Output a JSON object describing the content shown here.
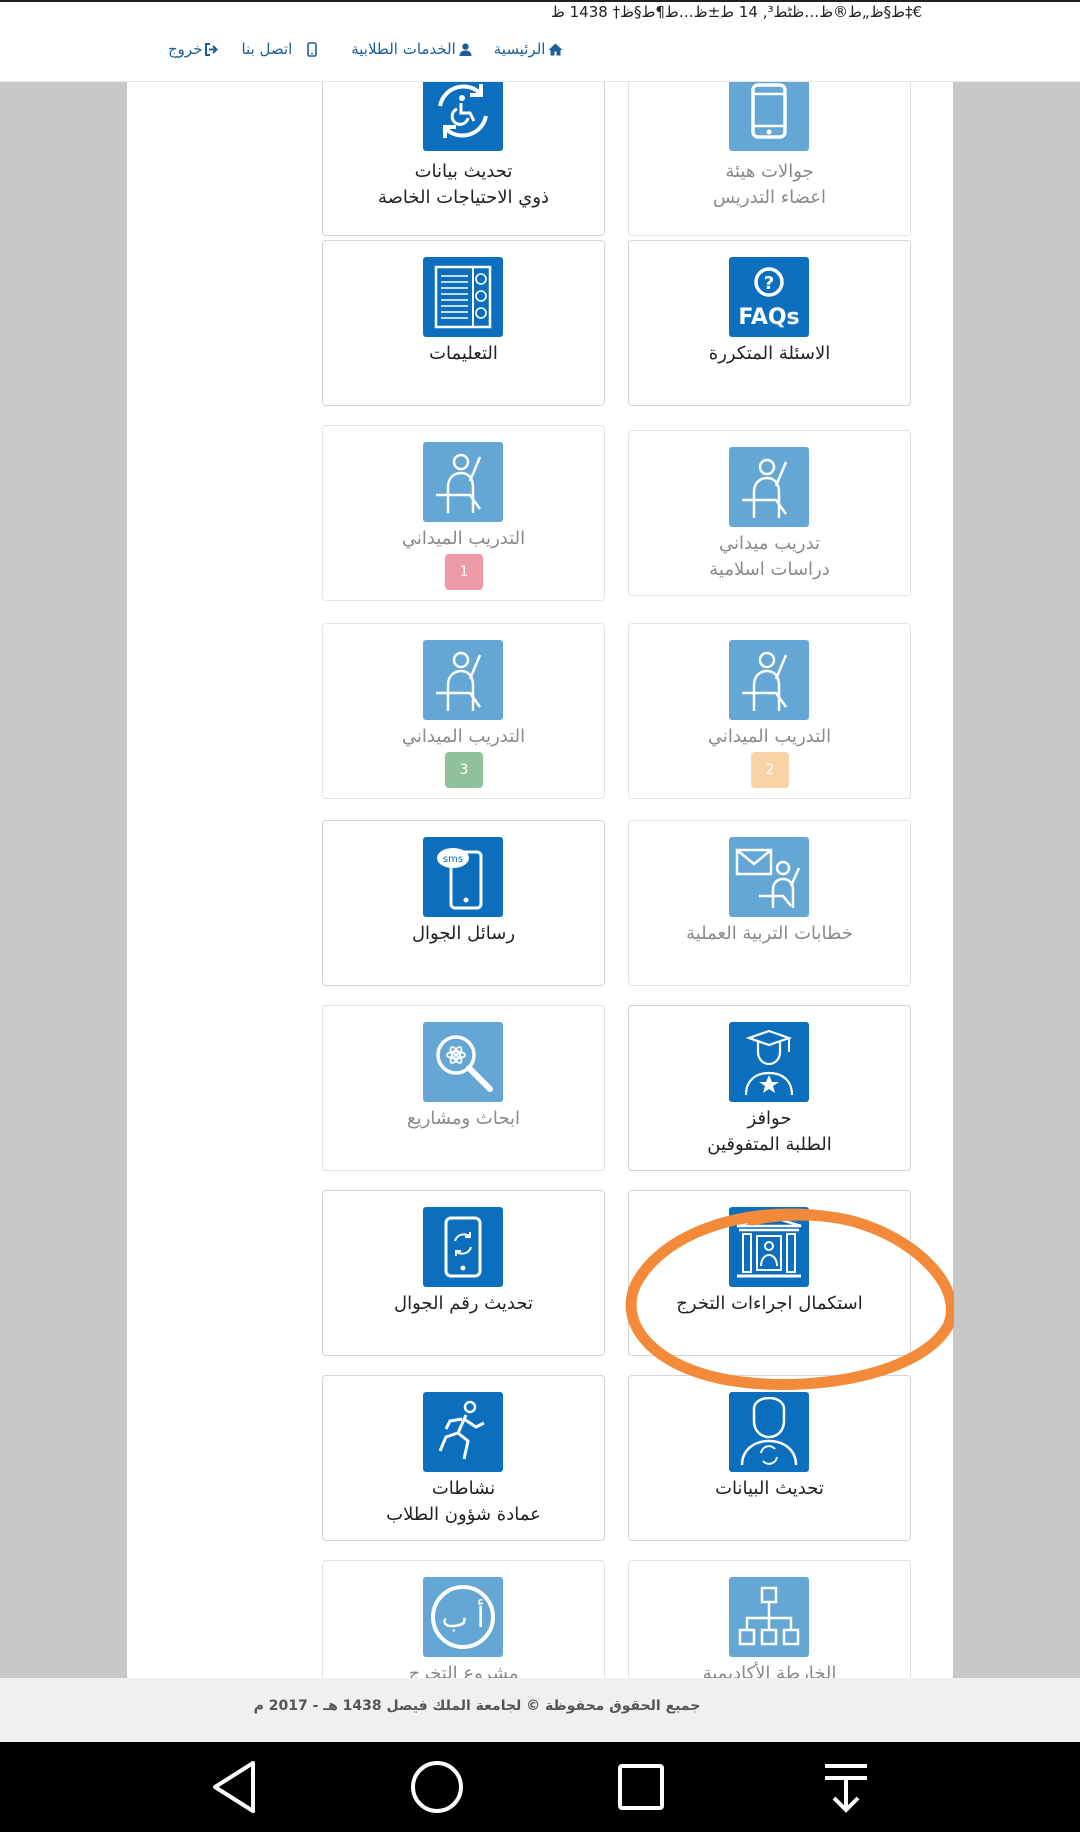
{
  "status": {
    "garbled_text": "ط§ظ„ط®ظ…ظٹط³, 14 ط±ظ…ط¶ط§ظ† 1438 ظ‡€"
  },
  "nav": {
    "home": "الرئيسية",
    "student_services": "الخدمات الطلابية",
    "contact": "اتصل بنا",
    "logout": "خروج"
  },
  "tiles": [
    {
      "line1": "تحديث بيانات",
      "line2": "ذوي الاحتياجات الخاصة",
      "icon": "accessibility-refresh-icon",
      "style": "dark"
    },
    {
      "line1": "جوالات هيئة",
      "line2": "اعضاء التدريس",
      "icon": "mobile-phone-icon",
      "style": "light"
    },
    {
      "line1": "التعليمات",
      "line2": "",
      "icon": "instructions-list-icon",
      "style": "dark"
    },
    {
      "line1": "الاسئلة المتكررة",
      "line2": "",
      "icon": "faqs-icon",
      "style": "dark"
    },
    {
      "line1": "التدريب الميداني",
      "line2": "",
      "badge": "1",
      "icon": "field-training-icon",
      "style": "light"
    },
    {
      "line1": "تدريب ميداني",
      "line2": "دراسات اسلامية",
      "icon": "field-training-icon",
      "style": "light"
    },
    {
      "line1": "التدريب الميداني",
      "line2": "",
      "badge": "3",
      "icon": "field-training-icon",
      "style": "light"
    },
    {
      "line1": "التدريب الميداني",
      "line2": "",
      "badge": "2",
      "icon": "field-training-icon",
      "style": "light"
    },
    {
      "line1": "رسائل الجوال",
      "line2": "",
      "icon": "sms-phone-icon",
      "style": "dark"
    },
    {
      "line1": "خطابات التربية العملية",
      "line2": "",
      "icon": "letter-teacher-icon",
      "style": "light"
    },
    {
      "line1": "ابحاث ومشاريع",
      "line2": "",
      "icon": "research-magnifier-icon",
      "style": "light"
    },
    {
      "line1": "حوافز",
      "line2": "الطلبة المتفوقين",
      "icon": "graduate-star-icon",
      "style": "dark"
    },
    {
      "line1": "تحديث رقم الجوال",
      "line2": "",
      "icon": "phone-refresh-icon",
      "style": "dark"
    },
    {
      "line1": "استكمال اجراءات التخرج",
      "line2": "",
      "icon": "graduation-building-icon",
      "style": "dark"
    },
    {
      "line1": "نشاطات",
      "line2": "عمادة شؤون الطلاب",
      "icon": "running-person-icon",
      "style": "dark"
    },
    {
      "line1": "تحديث البيانات",
      "line2": "",
      "icon": "profile-refresh-icon",
      "style": "dark"
    },
    {
      "line1": "مشروع التخرج",
      "line2": "",
      "icon": "arabic-letters-icon",
      "style": "light"
    },
    {
      "line1": "الخارطة الأكاديمية",
      "line2": "",
      "icon": "org-chart-icon",
      "style": "light"
    }
  ],
  "footer": {
    "copyright": "جميع الحقوق محفوظة © لجامعة الملك فيصل 1438 هـ - 2017 م"
  },
  "colors": {
    "nav_link": "#1a5f98",
    "icon_dark": "#0b6fbd",
    "icon_light": "#64a6d4",
    "badge_1": "#ec9aa6",
    "badge_2": "#f8d3a6",
    "badge_3": "#8fc19b",
    "annotation": "#f28a3a"
  }
}
